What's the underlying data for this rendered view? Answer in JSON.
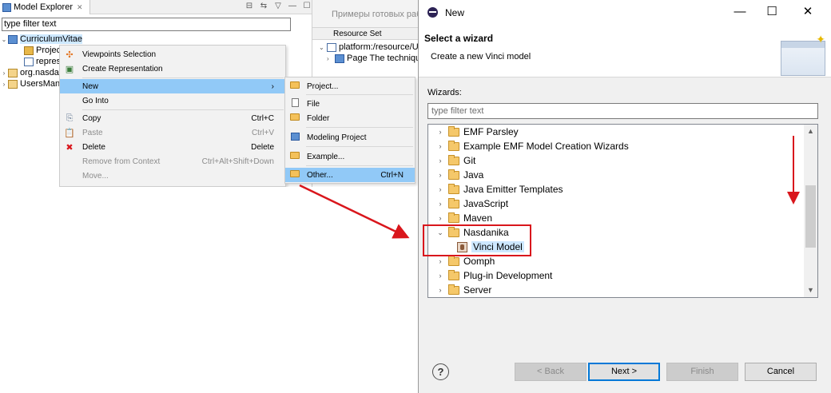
{
  "explorer": {
    "tab_title": "Model Explorer",
    "filter_value": "type filter text",
    "tree": [
      {
        "label": "CurriculumVitae",
        "expanded": true,
        "selected": true
      },
      {
        "label": "Project"
      },
      {
        "label": "represe"
      },
      {
        "label": "org.nasda"
      },
      {
        "label": "UsersMan"
      }
    ],
    "right_tab_title": "Примеры готовых раб",
    "resource_set_tab": "Resource Set",
    "resource_rows": [
      "platform:/resource/Us",
      "Page The techniqu"
    ]
  },
  "context_menu": {
    "items": [
      {
        "label": "Viewpoints Selection",
        "shortcut": "",
        "icon": "viewpoint-icon"
      },
      {
        "label": "Create Representation",
        "shortcut": "",
        "icon": "representation-icon"
      },
      {
        "label": "New",
        "shortcut": "",
        "icon": "",
        "submenu": true
      },
      {
        "label": "Go Into",
        "shortcut": ""
      },
      {
        "label": "Copy",
        "shortcut": "Ctrl+C",
        "icon": "copy-icon"
      },
      {
        "label": "Paste",
        "shortcut": "Ctrl+V",
        "icon": "paste-icon",
        "disabled": true
      },
      {
        "label": "Delete",
        "shortcut": "Delete",
        "icon": "delete-icon"
      },
      {
        "label": "Remove from Context",
        "shortcut": "Ctrl+Alt+Shift+Down",
        "disabled": true
      },
      {
        "label": "Move...",
        "shortcut": "",
        "disabled": true
      }
    ],
    "submenu": [
      {
        "label": "Project...",
        "shortcut": ""
      },
      {
        "label": "File",
        "shortcut": ""
      },
      {
        "label": "Folder",
        "shortcut": ""
      },
      {
        "label": "Modeling Project",
        "shortcut": ""
      },
      {
        "label": "Example...",
        "shortcut": ""
      },
      {
        "label": "Other...",
        "shortcut": "Ctrl+N"
      }
    ]
  },
  "dialog": {
    "title": "New",
    "heading": "Select a wizard",
    "description": "Create a new Vinci model",
    "wizards_label": "Wizards:",
    "filter_placeholder": "type filter text",
    "tree": [
      {
        "label": "EMF Parsley",
        "expanded": false
      },
      {
        "label": "Example EMF Model Creation Wizards",
        "expanded": false
      },
      {
        "label": "Git",
        "expanded": false
      },
      {
        "label": "Java",
        "expanded": false
      },
      {
        "label": "Java Emitter Templates",
        "expanded": false
      },
      {
        "label": "JavaScript",
        "expanded": false
      },
      {
        "label": "Maven",
        "expanded": false
      },
      {
        "label": "Nasdanika",
        "expanded": true
      },
      {
        "label": "Vinci Model",
        "child": true,
        "selected": true
      },
      {
        "label": "Oomph",
        "expanded": false
      },
      {
        "label": "Plug-in Development",
        "expanded": false
      },
      {
        "label": "Server",
        "expanded": false
      }
    ],
    "buttons": {
      "help": "?",
      "back": "< Back",
      "next": "Next >",
      "finish": "Finish",
      "cancel": "Cancel"
    },
    "window_controls": {
      "minimize": "—",
      "maximize": "☐",
      "close": "✕"
    }
  },
  "colors": {
    "annotation_red": "#d9161c",
    "menu_highlight": "#91c9f7",
    "selection": "#cde8ff"
  }
}
